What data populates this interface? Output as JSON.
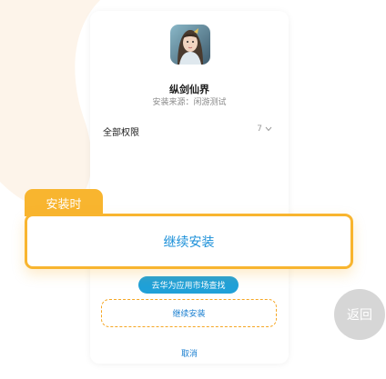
{
  "app": {
    "name": "纵剑仙界",
    "source": "安装来源：闲游测试"
  },
  "permissions": {
    "label": "全部权限",
    "count": "7"
  },
  "tag": {
    "label": "安装时"
  },
  "highlight": {
    "label": "继续安装"
  },
  "actions": {
    "go_market": "去华为应用市场查找",
    "continue": "继续安装",
    "cancel": "取消"
  },
  "back_button": {
    "label": "返回"
  },
  "colors": {
    "accent_orange": "#f8b52f",
    "accent_blue": "#1fa0d8",
    "link_blue": "#1a7fd0",
    "back_gray": "#d6d6d6"
  }
}
